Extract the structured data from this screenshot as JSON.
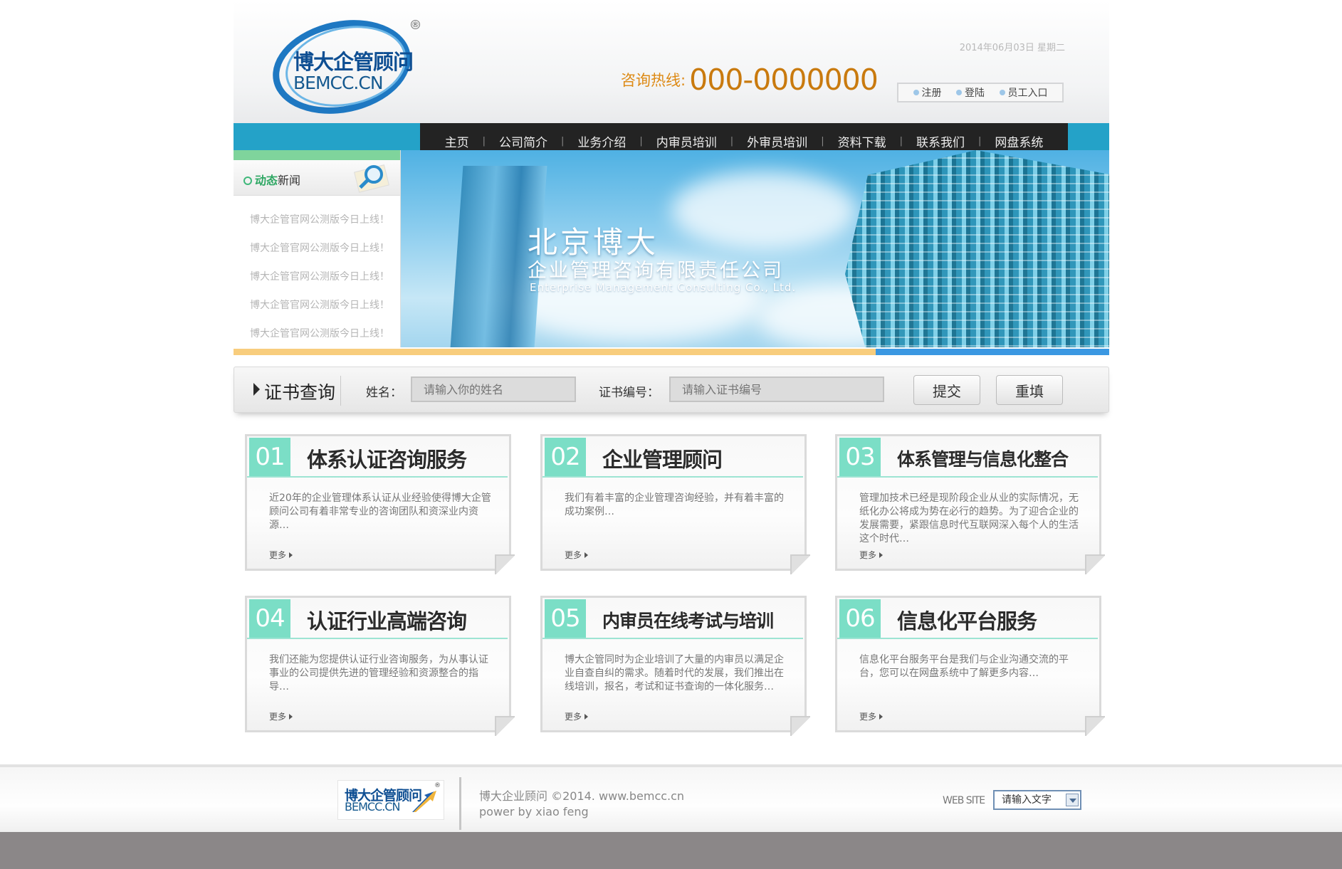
{
  "header": {
    "logo_cn": "博大企管顾问",
    "logo_en": "BEMCC.CN",
    "logo_reg": "®",
    "date": "2014年06月03日 星期二",
    "hotline_label": "咨询热线:",
    "hotline_number": "000-0000000",
    "user_links": [
      "注册",
      "登陆",
      "员工入口"
    ]
  },
  "nav": {
    "items": [
      "主页",
      "公司简介",
      "业务介绍",
      "内审员培训",
      "外审员培训",
      "资料下载",
      "联系我们",
      "网盘系统"
    ],
    "separator": "|"
  },
  "sidebar": {
    "title_highlight": "动态",
    "title_rest": "新闻",
    "news": [
      "博大企管官网公测版今日上线！",
      "博大企管官网公测版今日上线！",
      "博大企管官网公测版今日上线！",
      "博大企管官网公测版今日上线！",
      "博大企管官网公测版今日上线！"
    ]
  },
  "banner": {
    "title_cn": "北京博大",
    "subtitle_cn": "企业管理咨询有限责任公司",
    "subtitle_en": "Enterprise Management Consulting Co., Ltd."
  },
  "cert": {
    "title": "证书查询",
    "name_label": "姓名：",
    "name_placeholder": "请输入你的姓名",
    "id_label": "证书编号：",
    "id_placeholder": "请输入证书编号",
    "submit": "提交",
    "reset": "重填"
  },
  "services": [
    {
      "num": "01",
      "title": "体系认证咨询服务",
      "text": "近20年的企业管理体系认证从业经验使得博大企管顾问公司有着非常专业的咨询团队和资深业内资源…",
      "more": "更多"
    },
    {
      "num": "02",
      "title": "企业管理顾问",
      "text": "我们有着丰富的企业管理咨询经验，并有着丰富的成功案例…",
      "more": "更多"
    },
    {
      "num": "03",
      "title": "体系管理与信息化整合",
      "text": "管理加技术已经是现阶段企业从业的实际情况，无纸化办公将成为势在必行的趋势。为了迎合企业的发展需要，紧跟信息时代互联网深入每个人的生活这个时代…",
      "more": "更多"
    },
    {
      "num": "04",
      "title": "认证行业高端咨询",
      "text": "我们还能为您提供认证行业咨询服务，为从事认证事业的公司提供先进的管理经验和资源整合的指导…",
      "more": "更多"
    },
    {
      "num": "05",
      "title": "内审员在线考试与培训",
      "text": "博大企管同时为企业培训了大量的内审员以满足企业自查自纠的需求。随着时代的发展，我们推出在线培训，报名，考试和证书查询的一体化服务…",
      "more": "更多"
    },
    {
      "num": "06",
      "title": "信息化平台服务",
      "text": "信息化平台服务平台是我们与企业沟通交流的平台，您可以在网盘系统中了解更多内容…",
      "more": "更多"
    }
  ],
  "footer": {
    "logo_cn": "博大企管顾问",
    "logo_en": "BEMCC.CN",
    "copyright": "博大企业顾问 ©2014. www.bemcc.cn",
    "power": "power by xiao feng",
    "website_label": "WEB SITE",
    "select_value": "请输入文字"
  }
}
